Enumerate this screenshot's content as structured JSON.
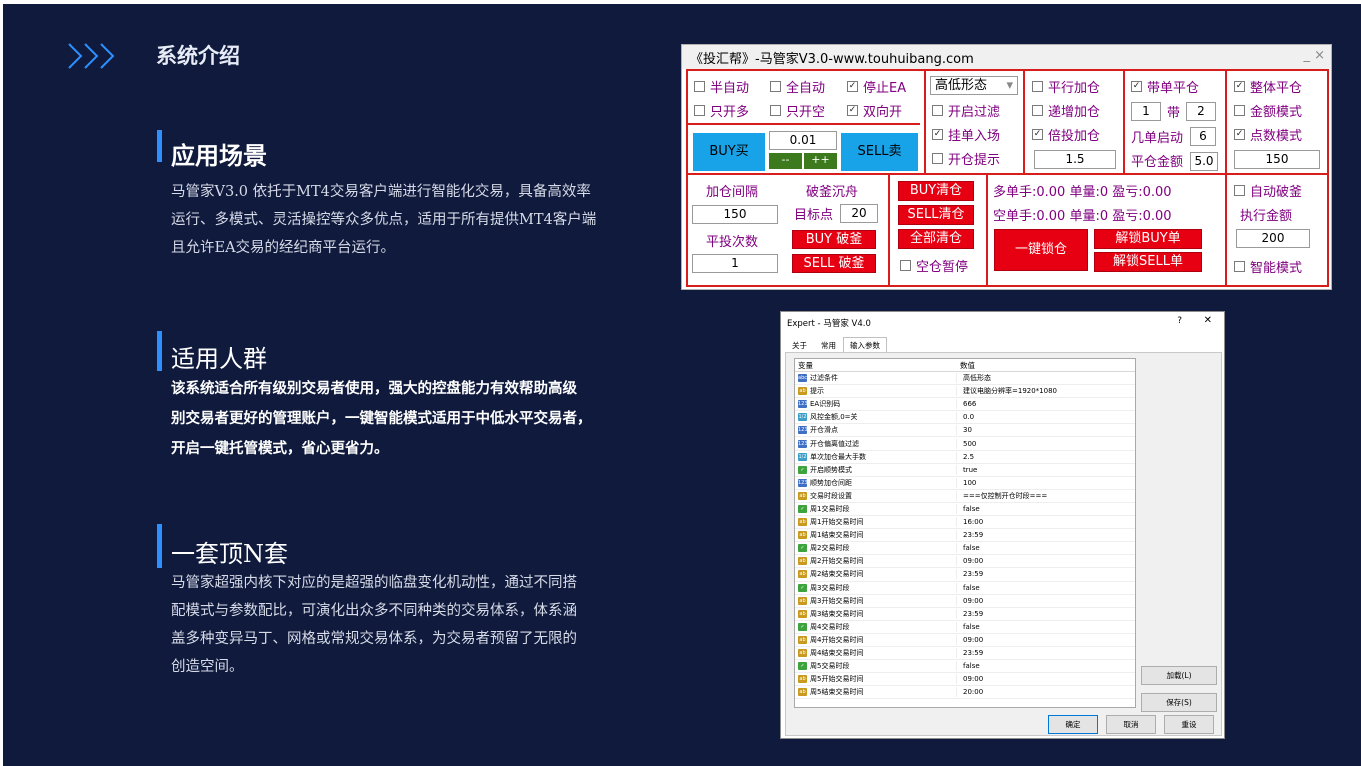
{
  "header": {
    "title": "系统介绍"
  },
  "sections": [
    {
      "title": "应用场景",
      "body": [
        "马管家V3.0 依托于MT4交易客户端进行智能化交易，具备高效率",
        "运行、多模式、灵活操控等众多优点，适用于所有提供MT4客户端",
        "且允许EA交易的经纪商平台运行。"
      ]
    },
    {
      "title": "适用人群",
      "body": [
        "该系统适合所有级别交易者使用，强大的控盘能力有效帮助高级",
        "别交易者更好的管理账户，一键智能模式适用于中低水平交易者，",
        "开启一键托管模式，省心更省力。"
      ]
    },
    {
      "title": "一套顶N套",
      "body": [
        "马管家超强内核下对应的是超强的临盘变化机动性，通过不同搭",
        "配模式与参数配比，可演化出众多不同种类的交易体系，体系涵",
        "盖多种变异马丁、网格或常规交易体系，为交易者预留了无限的",
        "创造空间。"
      ]
    }
  ],
  "panel": {
    "title": "《投汇帮》-马管家V3.0-www.touhuibang.com",
    "win_controls": "_ ×",
    "checkboxes": {
      "semi_auto": "半自动",
      "full_auto": "全自动",
      "stop_ea": "停止EA",
      "only_long": "只开多",
      "only_short": "只开空",
      "both": "双向开",
      "parallel": "平行加仓",
      "increment": "递增加仓",
      "multiply": "倍投加仓",
      "with_close": "带单平仓",
      "whole_close": "整体平仓",
      "amount_mode": "金额模式",
      "points_mode": "点数模式",
      "open_filter": "开启过滤",
      "pending": "挂单入场",
      "open_hint": "开仓提示",
      "auto_break": "自动破釜",
      "smart_mode": "智能模式",
      "empty_pause": "空仓暂停"
    },
    "checked": [
      "stop_ea",
      "both",
      "pending",
      "multiply",
      "with_close",
      "whole_close",
      "points_mode"
    ],
    "check_mark": "✓",
    "select_value": "高低形态",
    "select_arrow": "▾",
    "lot": "0.01",
    "minus": "--",
    "plus": "++",
    "buy_label": "BUY买",
    "sell_label": "SELL卖",
    "with_label": "带",
    "with_a": "1",
    "with_b": "2",
    "multi_start_label": "几单启动",
    "multi_start": "6",
    "close_amount_label": "平仓金额",
    "close_amount": "5.0",
    "multiplier": "1.5",
    "points": "150",
    "add_interval_label": "加仓间隔",
    "add_interval": "150",
    "close_times_label": "平投次数",
    "close_times": "1",
    "break_label": "破釜沉舟",
    "target_label": "目标点",
    "target": "20",
    "buy_break": "BUY 破釜",
    "sell_break": "SELL 破釜",
    "buy_clear": "BUY清仓",
    "sell_clear": "SELL清仓",
    "all_clear": "全部清仓",
    "long_stats": "多单手:0.00 单量:0 盈亏:0.00",
    "short_stats": "空单手:0.00 单量:0 盈亏:0.00",
    "one_key_lock": "一键锁仓",
    "unlock_buy": "解锁BUY单",
    "unlock_sell": "解锁SELL单",
    "exec_amount_label": "执行金额",
    "exec_amount": "200"
  },
  "dialog": {
    "title": "Expert - 马管家 V4.0",
    "help": "?",
    "close": "✕",
    "tabs": [
      "关于",
      "常用",
      "输入参数"
    ],
    "col_var": "变量",
    "col_val": "数值",
    "rows": [
      {
        "icon": "ico-num",
        "ico": "abc",
        "name": "过滤条件",
        "value": "高低形态"
      },
      {
        "icon": "ico-ab",
        "ico": "ab",
        "name": "提示",
        "value": "建议电脑分辨率=1920*1080"
      },
      {
        "icon": "ico-num",
        "ico": "123",
        "name": "EA识别码",
        "value": "666"
      },
      {
        "icon": "ico-dbl",
        "ico": "1/2",
        "name": "风控金额,0=关",
        "value": "0.0"
      },
      {
        "icon": "ico-num",
        "ico": "123",
        "name": "开仓滑点",
        "value": "30"
      },
      {
        "icon": "ico-num",
        "ico": "123",
        "name": "开仓偏离值过滤",
        "value": "500"
      },
      {
        "icon": "ico-dbl",
        "ico": "1/2",
        "name": "单次加仓最大手数",
        "value": "2.5"
      },
      {
        "icon": "ico-chk",
        "ico": "✓",
        "name": "开启顺势模式",
        "value": "true"
      },
      {
        "icon": "ico-num",
        "ico": "123",
        "name": "顺势加仓间距",
        "value": "100"
      },
      {
        "icon": "ico-ab",
        "ico": "ab",
        "name": "交易时段设置",
        "value": "===仅控制开仓时段==="
      },
      {
        "icon": "ico-chk",
        "ico": "✓",
        "name": "周1交易时段",
        "value": "false"
      },
      {
        "icon": "ico-ab",
        "ico": "ab",
        "name": "周1开始交易时间",
        "value": "16:00"
      },
      {
        "icon": "ico-ab",
        "ico": "ab",
        "name": "周1结束交易时间",
        "value": "23:59"
      },
      {
        "icon": "ico-chk",
        "ico": "✓",
        "name": "周2交易时段",
        "value": "false"
      },
      {
        "icon": "ico-ab",
        "ico": "ab",
        "name": "周2开始交易时间",
        "value": "09:00"
      },
      {
        "icon": "ico-ab",
        "ico": "ab",
        "name": "周2结束交易时间",
        "value": "23:59"
      },
      {
        "icon": "ico-chk",
        "ico": "✓",
        "name": "周3交易时段",
        "value": "false"
      },
      {
        "icon": "ico-ab",
        "ico": "ab",
        "name": "周3开始交易时间",
        "value": "09:00"
      },
      {
        "icon": "ico-ab",
        "ico": "ab",
        "name": "周3结束交易时间",
        "value": "23:59"
      },
      {
        "icon": "ico-chk",
        "ico": "✓",
        "name": "周4交易时段",
        "value": "false"
      },
      {
        "icon": "ico-ab",
        "ico": "ab",
        "name": "周4开始交易时间",
        "value": "09:00"
      },
      {
        "icon": "ico-ab",
        "ico": "ab",
        "name": "周4结束交易时间",
        "value": "23:59"
      },
      {
        "icon": "ico-chk",
        "ico": "✓",
        "name": "周5交易时段",
        "value": "false"
      },
      {
        "icon": "ico-ab",
        "ico": "ab",
        "name": "周5开始交易时间",
        "value": "09:00"
      },
      {
        "icon": "ico-ab",
        "ico": "ab",
        "name": "周5结束交易时间",
        "value": "20:00"
      }
    ],
    "load": "加载(L)",
    "save": "保存(S)",
    "ok": "确定",
    "cancel": "取消",
    "reset": "重设"
  },
  "colors": {
    "background": "#0f1a3d",
    "accent": "#2e8fff",
    "panel_border": "#d91c1c",
    "panel_text": "#800080",
    "red_button": "#e60012",
    "blue_button": "#18a3e8"
  }
}
